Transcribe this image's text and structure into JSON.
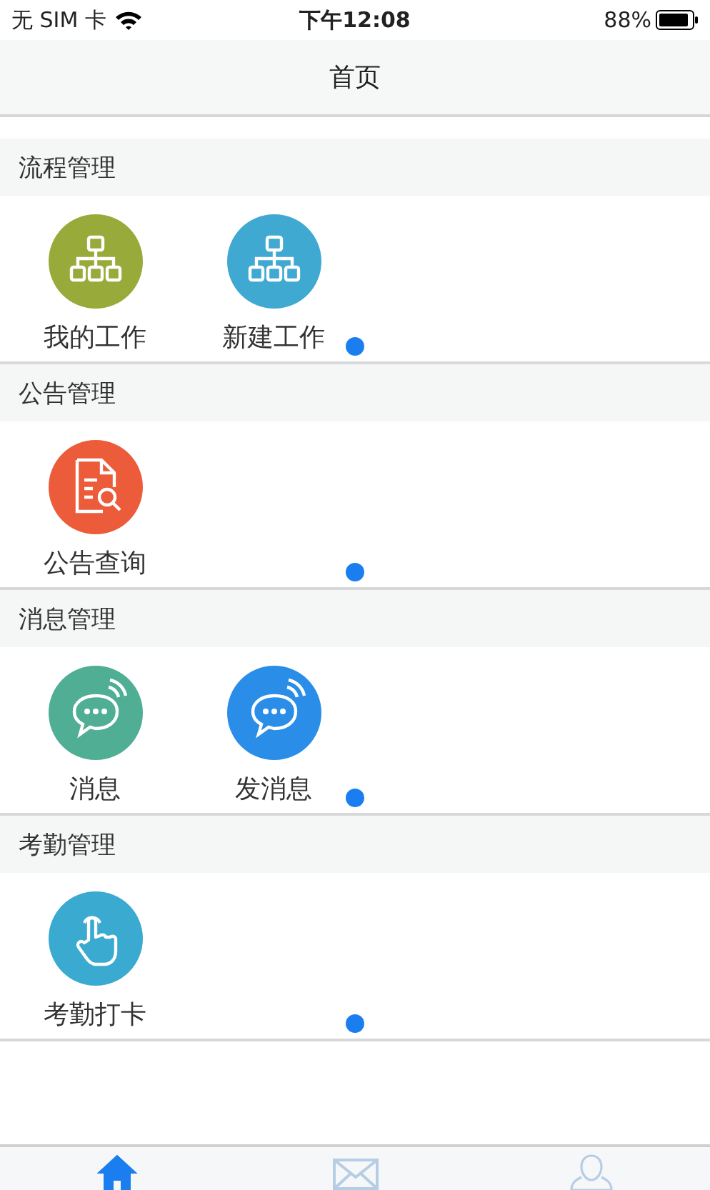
{
  "status_bar": {
    "carrier": "无 SIM 卡",
    "time": "下午12:08",
    "battery": "88%"
  },
  "nav_bar": {
    "title": "首页"
  },
  "sections": [
    {
      "title": "流程管理",
      "items": [
        {
          "label": "我的工作",
          "kind": "org-chart",
          "color": "#98aa3a"
        },
        {
          "label": "新建工作",
          "kind": "org-chart",
          "color": "#3fa9d2"
        }
      ]
    },
    {
      "title": "公告管理",
      "items": [
        {
          "label": "公告查询",
          "kind": "document-search",
          "color": "#ec5b3a"
        }
      ]
    },
    {
      "title": "消息管理",
      "items": [
        {
          "label": "消息",
          "kind": "chat",
          "color": "#4fae94"
        },
        {
          "label": "发消息",
          "kind": "chat",
          "color": "#2a8ee8"
        }
      ]
    },
    {
      "title": "考勤管理",
      "items": [
        {
          "label": "考勤打卡",
          "kind": "hand-tap",
          "color": "#3aaad0"
        }
      ]
    }
  ],
  "tab_bar": [
    {
      "kind": "home",
      "selected": true
    },
    {
      "kind": "mail",
      "selected": false
    },
    {
      "kind": "person",
      "selected": false
    }
  ]
}
